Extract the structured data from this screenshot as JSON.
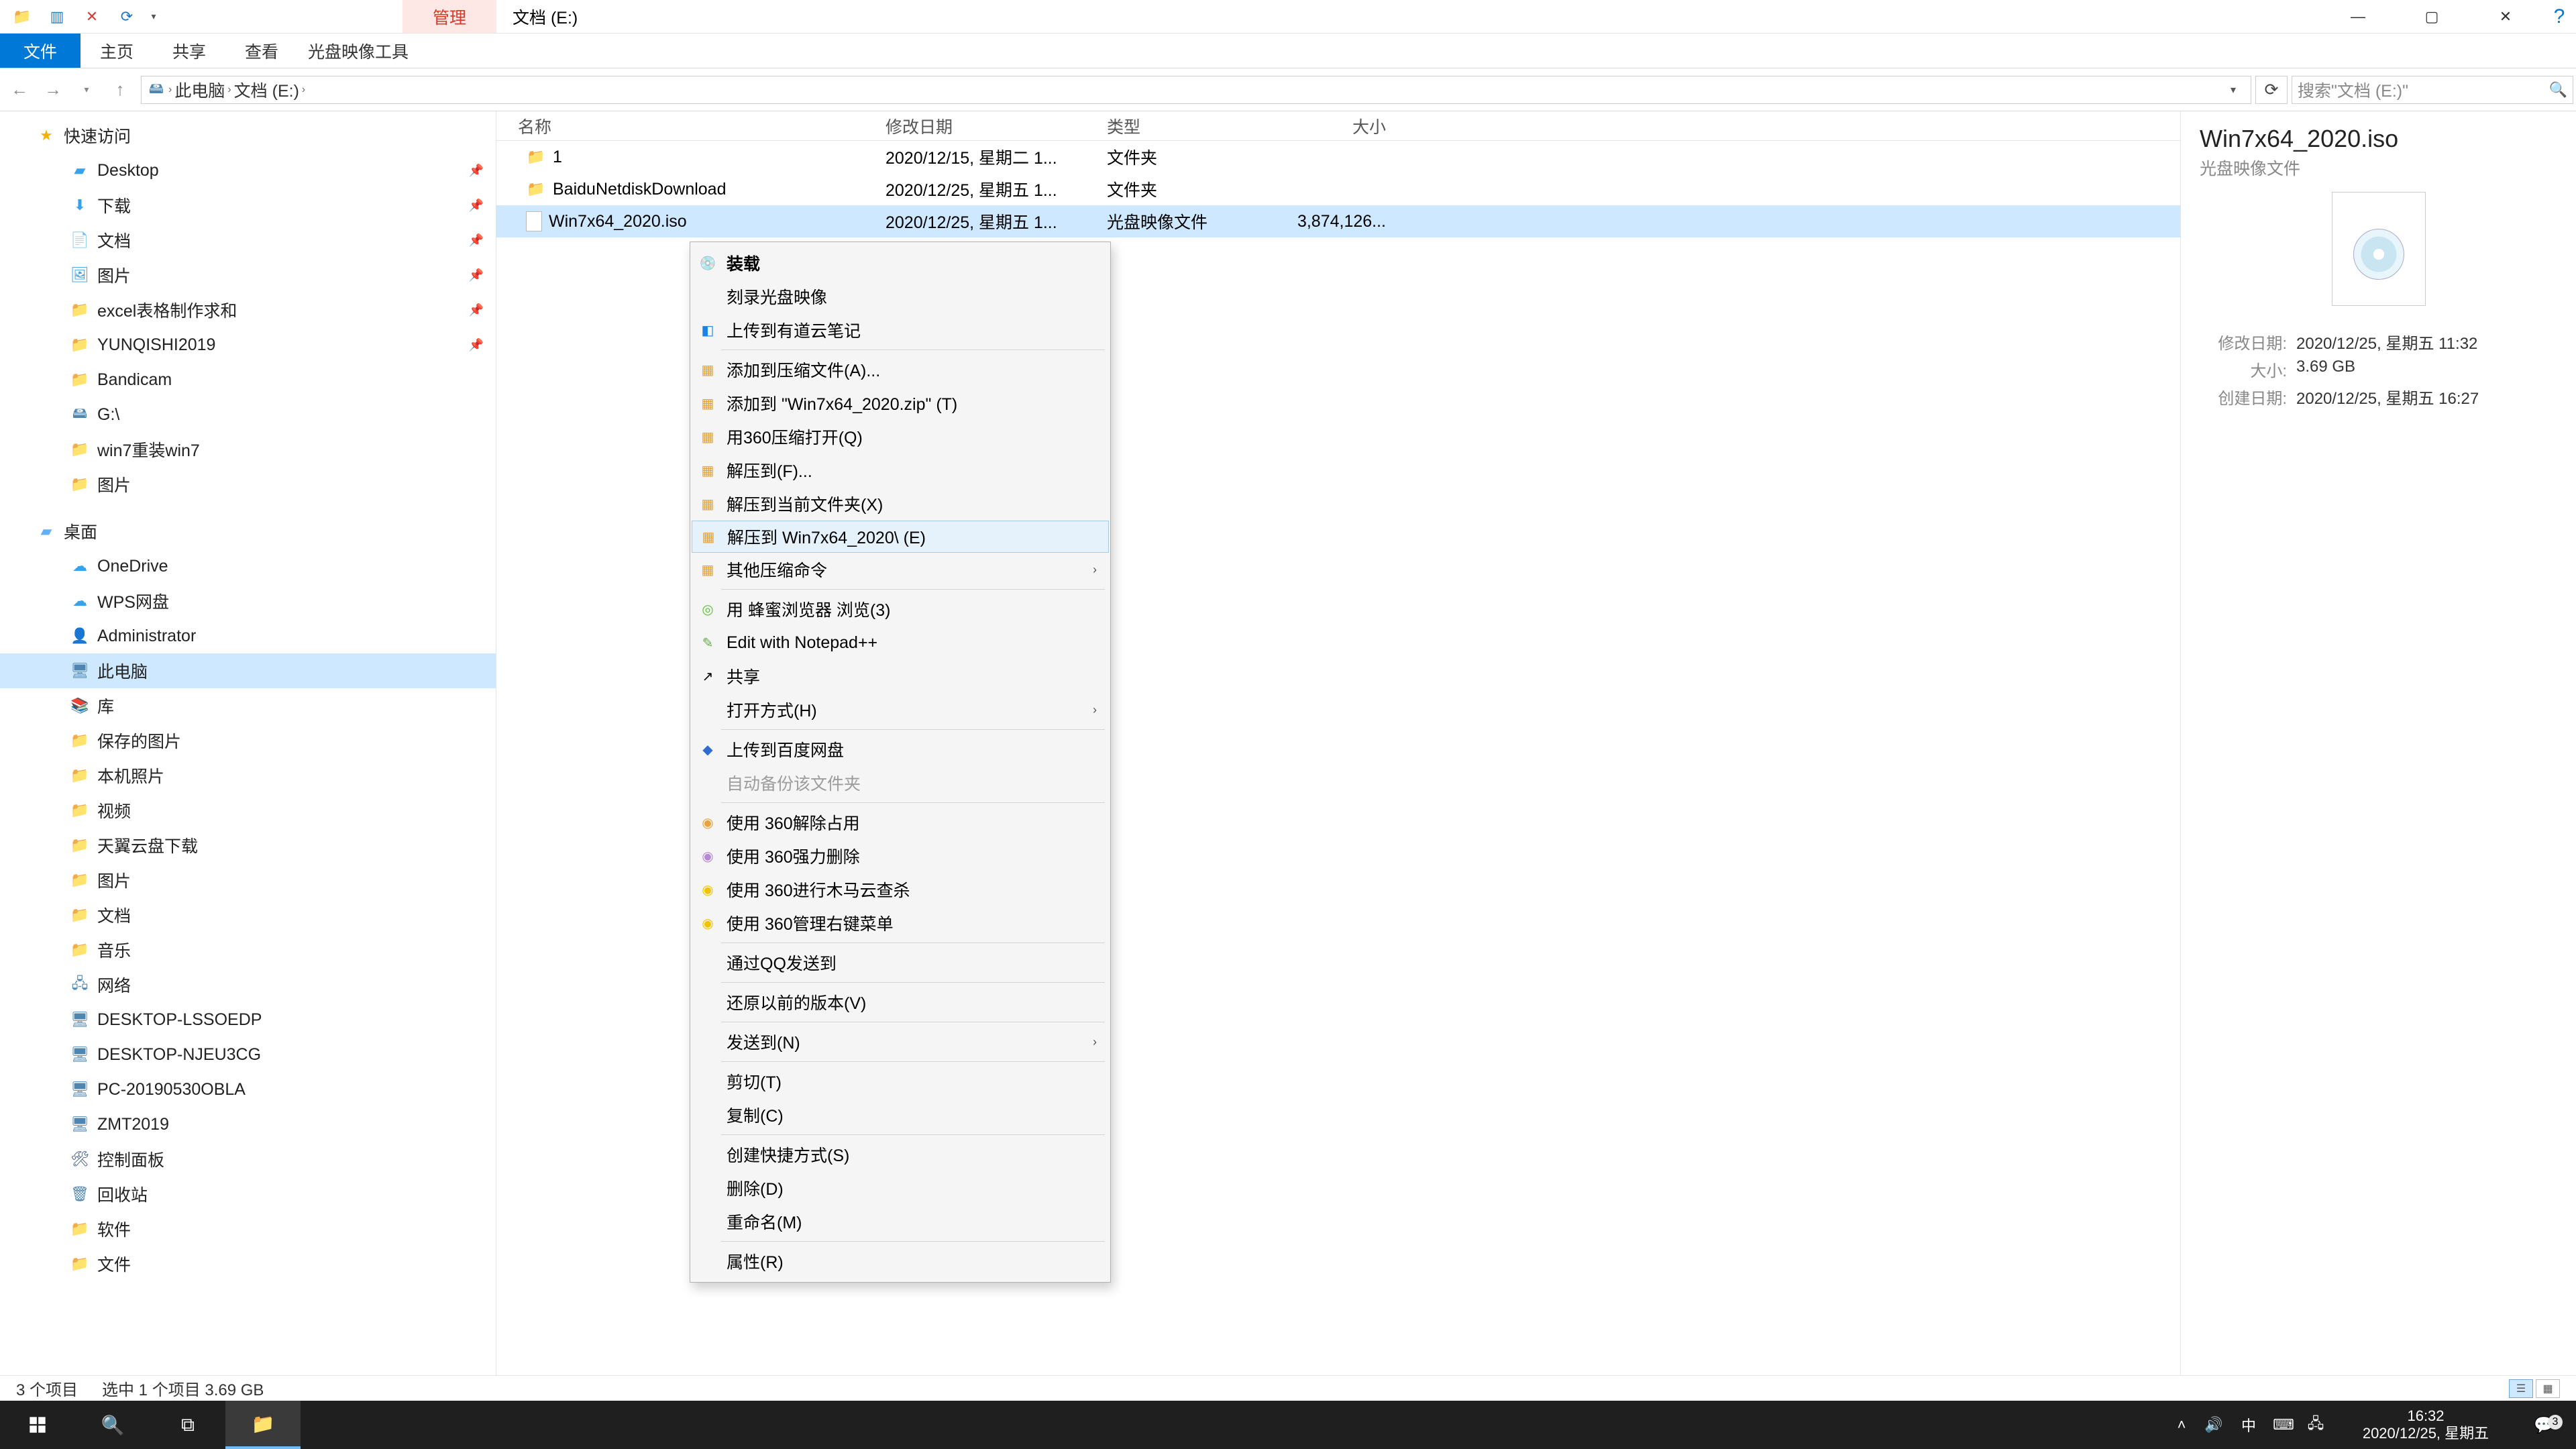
{
  "title_context": "管理",
  "title_location": "文档 (E:)",
  "ribbon": {
    "file": "文件",
    "home": "主页",
    "share": "共享",
    "view": "查看",
    "tool": "光盘映像工具"
  },
  "breadcrumb": {
    "root": "此电脑",
    "here": "文档 (E:)"
  },
  "search_placeholder": "搜索\"文档 (E:)\"",
  "tree": {
    "quick": "快速访问",
    "desktop1": "Desktop",
    "downloads": "下载",
    "docs": "文档",
    "pics1": "图片",
    "excel": "excel表格制作求和",
    "yun": "YUNQISHI2019",
    "bandicam": "Bandicam",
    "gdrive": "G:\\",
    "win7re": "win7重装win7",
    "pics2": "图片",
    "desktop_sec": "桌面",
    "onedrive": "OneDrive",
    "wps": "WPS网盘",
    "admin": "Administrator",
    "thispc": "此电脑",
    "lib": "库",
    "saved": "保存的图片",
    "localcam": "本机照片",
    "video": "视频",
    "tianyi": "天翼云盘下载",
    "pics3": "图片",
    "docs2": "文档",
    "music": "音乐",
    "network": "网络",
    "nw1": "DESKTOP-LSSOEDP",
    "nw2": "DESKTOP-NJEU3CG",
    "nw3": "PC-20190530OBLA",
    "nw4": "ZMT2019",
    "cpanel": "控制面板",
    "recycle": "回收站",
    "soft": "软件",
    "files": "文件"
  },
  "cols": {
    "name": "名称",
    "date": "修改日期",
    "type": "类型",
    "size": "大小"
  },
  "rows": [
    {
      "name": "1",
      "date": "2020/12/15, 星期二 1...",
      "type": "文件夹",
      "size": ""
    },
    {
      "name": "BaiduNetdiskDownload",
      "date": "2020/12/25, 星期五 1...",
      "type": "文件夹",
      "size": ""
    },
    {
      "name": "Win7x64_2020.iso",
      "date": "2020/12/25, 星期五 1...",
      "type": "光盘映像文件",
      "size": "3,874,126..."
    }
  ],
  "ctx": {
    "mount": "装载",
    "burn": "刻录光盘映像",
    "youdao": "上传到有道云笔记",
    "addzip": "添加到压缩文件(A)...",
    "addzip2": "添加到 \"Win7x64_2020.zip\" (T)",
    "open360": "用360压缩打开(Q)",
    "extract": "解压到(F)...",
    "extracthere": "解压到当前文件夹(X)",
    "extractnamed": "解压到 Win7x64_2020\\ (E)",
    "othercomp": "其他压缩命令",
    "fengmi": "用 蜂蜜浏览器 浏览(3)",
    "notepad": "Edit with Notepad++",
    "share": "共享",
    "openwith": "打开方式(H)",
    "baidu": "上传到百度网盘",
    "autobak": "自动备份该文件夹",
    "u360a": "使用 360解除占用",
    "u360b": "使用 360强力删除",
    "u360c": "使用 360进行木马云查杀",
    "u360d": "使用 360管理右键菜单",
    "qqsend": "通过QQ发送到",
    "restore": "还原以前的版本(V)",
    "sendto": "发送到(N)",
    "cut": "剪切(T)",
    "copy": "复制(C)",
    "shortcut": "创建快捷方式(S)",
    "delete": "删除(D)",
    "rename": "重命名(M)",
    "props": "属性(R)"
  },
  "details": {
    "title": "Win7x64_2020.iso",
    "type": "光盘映像文件",
    "k_m": "修改日期:",
    "v_m": "2020/12/25, 星期五 11:32",
    "k_s": "大小:",
    "v_s": "3.69 GB",
    "k_c": "创建日期:",
    "v_c": "2020/12/25, 星期五 16:27"
  },
  "status": {
    "count": "3 个项目",
    "sel": "选中 1 个项目  3.69 GB"
  },
  "clock": {
    "time": "16:32",
    "date": "2020/12/25, 星期五"
  },
  "ime": "中",
  "notif_count": "3"
}
